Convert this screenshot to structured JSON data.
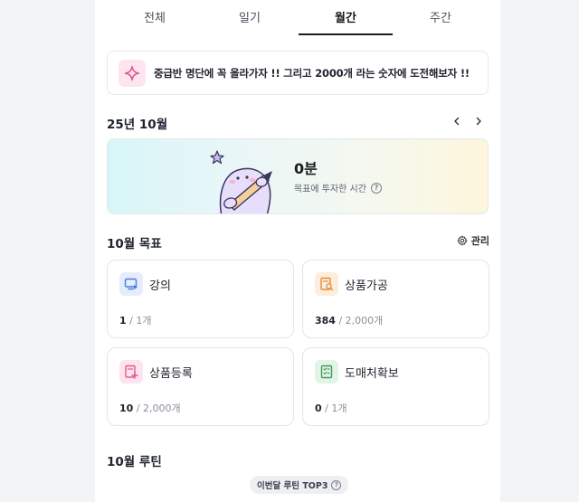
{
  "tabs": [
    {
      "label": "전체"
    },
    {
      "label": "일기"
    },
    {
      "label": "월간"
    },
    {
      "label": "주간"
    }
  ],
  "active_tab": "월간",
  "banner": {
    "text": "중급반 명단에 꼭 올라가자 !! 그리고 2000개 라는 숫자에 도전해보자 !!",
    "icon": "sparkle-icon"
  },
  "month": {
    "title": "25년 10월",
    "prev_icon": "chevron-left-icon",
    "next_icon": "chevron-right-icon"
  },
  "summary": {
    "value": "0분",
    "caption": "목표에 투자한 시간",
    "help": "?"
  },
  "goals": {
    "title": "10월 목표",
    "manage_label": "관리",
    "items": [
      {
        "name": "강의",
        "current": "1",
        "target": "/ 1개",
        "icon": "monitor-play-icon",
        "color": "#4a78e0",
        "bg": "#e5edfc"
      },
      {
        "name": "상품가공",
        "current": "384",
        "target": "/ 2,000개",
        "icon": "magnify-doc-icon",
        "color": "#e38a3c",
        "bg": "#fdeddc"
      },
      {
        "name": "상품등록",
        "current": "10",
        "target": "/ 2,000개",
        "icon": "add-doc-icon",
        "color": "#e25a8a",
        "bg": "#fde4ee"
      },
      {
        "name": "도매처확보",
        "current": "0",
        "target": "/ 1개",
        "icon": "checklist-icon",
        "color": "#3f9a5a",
        "bg": "#e2f4e6"
      }
    ]
  },
  "routine": {
    "title": "10월 루틴",
    "top_label": "이번달 루틴 TOP3",
    "help": "?"
  }
}
